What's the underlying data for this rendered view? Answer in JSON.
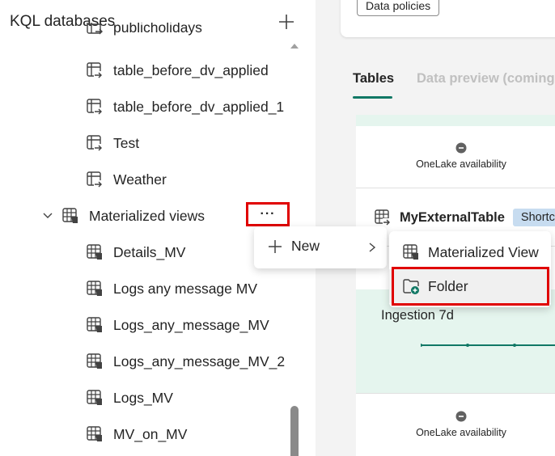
{
  "panel": {
    "title": "KQL databases",
    "add_icon": "plus-icon"
  },
  "tree": {
    "clipped_item": "publicholidays",
    "tables": [
      {
        "label": "table_before_dv_applied",
        "icon": "shortcut-table-icon"
      },
      {
        "label": "table_before_dv_applied_1",
        "icon": "shortcut-table-icon"
      },
      {
        "label": "Test",
        "icon": "shortcut-table-icon"
      },
      {
        "label": "Weather",
        "icon": "shortcut-table-icon"
      }
    ],
    "group": {
      "label": "Materialized views",
      "icon": "materialized-view-icon",
      "more_label": "···"
    },
    "views": [
      {
        "label": "Details_MV"
      },
      {
        "label": "Logs any message MV"
      },
      {
        "label": "Logs_any_message_MV"
      },
      {
        "label": "Logs_any_message_MV_2"
      },
      {
        "label": "Logs_MV"
      },
      {
        "label": "MV_on_MV"
      }
    ]
  },
  "right": {
    "data_policies": "Data policies",
    "tabs": [
      {
        "label": "Tables",
        "active": true
      },
      {
        "label": "Data preview (coming",
        "active": false
      }
    ],
    "onelake_label": "OneLake availability",
    "external_table": "MyExternalTable",
    "shortcut_badge": "Shortc",
    "ingestion_title": "Ingestion 7d"
  },
  "context_menu": {
    "new_label": "New",
    "submenu": [
      {
        "label": "Materialized View",
        "icon": "materialized-view-icon"
      },
      {
        "label": "Folder",
        "icon": "folder-add-icon"
      }
    ]
  },
  "colors": {
    "accent": "#117865",
    "highlight": "#e00000",
    "green_band": "#e5f5ee",
    "badge": "#c7dcf0"
  }
}
